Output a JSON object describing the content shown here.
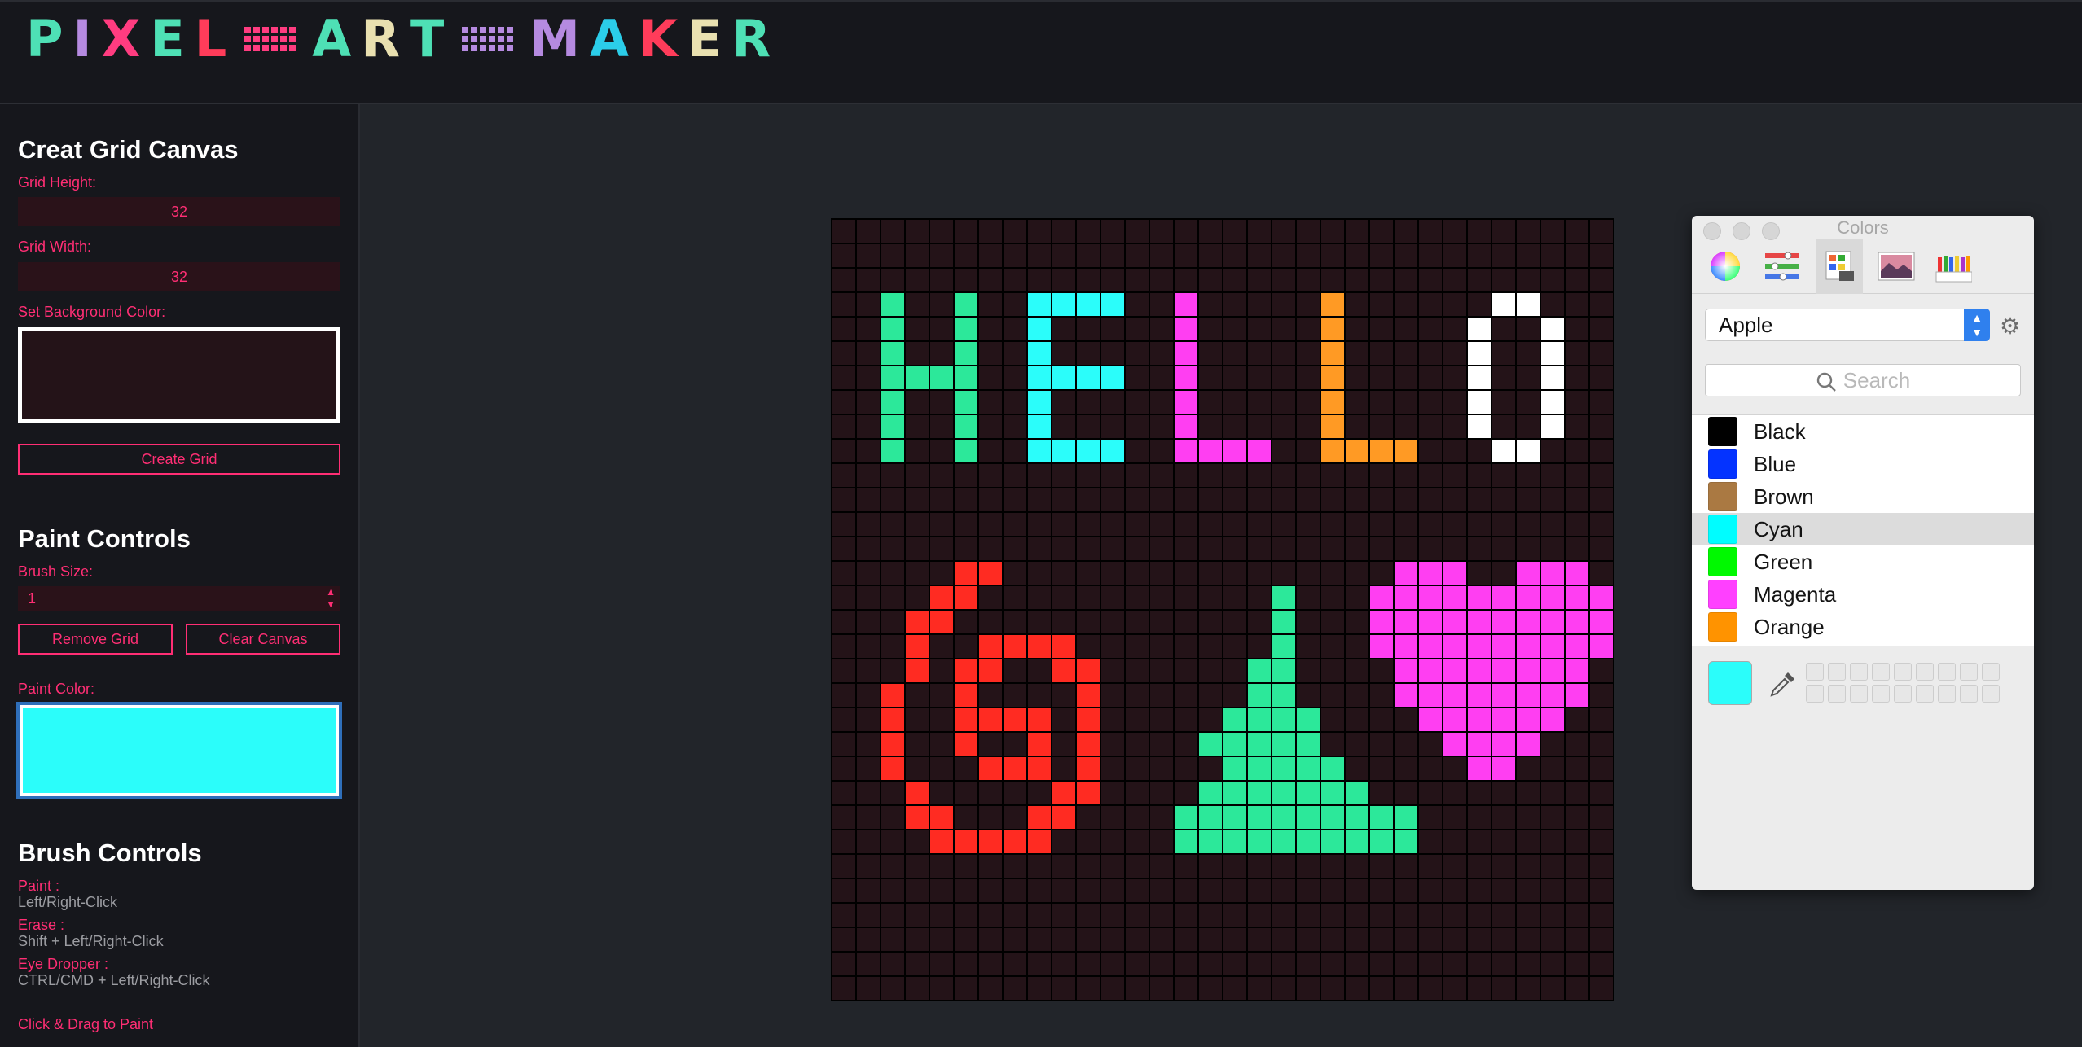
{
  "logo": {
    "letters": [
      {
        "ch": "P",
        "color": "#4ee0b5"
      },
      {
        "ch": "I",
        "color": "#b58ae0"
      },
      {
        "ch": "X",
        "color": "#ff3c80"
      },
      {
        "ch": "E",
        "color": "#4ee0b5"
      },
      {
        "ch": "L",
        "color": "#ff3c5a"
      },
      {
        "sep": true,
        "color": "#ff3c80"
      },
      {
        "ch": "A",
        "color": "#4ee0b5"
      },
      {
        "ch": "R",
        "color": "#e9e0b0"
      },
      {
        "ch": "T",
        "color": "#4ee0b5"
      },
      {
        "sep": true,
        "color": "#b58ae0"
      },
      {
        "ch": "M",
        "color": "#b58ae0"
      },
      {
        "ch": "A",
        "color": "#2bcde9"
      },
      {
        "ch": "K",
        "color": "#ff3c5a"
      },
      {
        "ch": "E",
        "color": "#e9e0b0"
      },
      {
        "ch": "R",
        "color": "#4ee0b5"
      }
    ]
  },
  "sidebar": {
    "create_title": "Creat Grid Canvas",
    "grid_height_label": "Grid Height:",
    "grid_height_value": "32",
    "grid_width_label": "Grid Width:",
    "grid_width_value": "32",
    "bg_color_label": "Set Background Color:",
    "bg_color": "#241318",
    "create_button": "Create Grid",
    "paint_title": "Paint Controls",
    "brush_size_label": "Brush Size:",
    "brush_size_value": "1",
    "remove_grid_button": "Remove Grid",
    "clear_canvas_button": "Clear Canvas",
    "paint_color_label": "Paint Color:",
    "paint_color": "#2bfdfa",
    "brush_title": "Brush Controls",
    "paint_label": "Paint :",
    "paint_hint": "Left/Right-Click",
    "erase_label": "Erase :",
    "erase_hint": "Shift + Left/Right-Click",
    "eyedropper_label": "Eye Dropper :",
    "eyedropper_hint": "CTRL/CMD + Left/Right-Click",
    "drag_hint": "Click & Drag to Paint"
  },
  "canvas": {
    "rows": 32,
    "cols": 32,
    "background": "#241318",
    "pixels": [
      {
        "color": "#2ce89a",
        "cells": [
          [
            3,
            2
          ],
          [
            4,
            2
          ],
          [
            5,
            2
          ],
          [
            6,
            2
          ],
          [
            7,
            2
          ],
          [
            8,
            2
          ],
          [
            9,
            2
          ],
          [
            3,
            5
          ],
          [
            4,
            5
          ],
          [
            5,
            5
          ],
          [
            6,
            5
          ],
          [
            7,
            5
          ],
          [
            8,
            5
          ],
          [
            9,
            5
          ],
          [
            6,
            3
          ],
          [
            6,
            4
          ]
        ]
      },
      {
        "color": "#2bfdfa",
        "cells": [
          [
            3,
            8
          ],
          [
            3,
            9
          ],
          [
            3,
            10
          ],
          [
            3,
            11
          ],
          [
            4,
            8
          ],
          [
            5,
            8
          ],
          [
            6,
            8
          ],
          [
            7,
            8
          ],
          [
            8,
            8
          ],
          [
            9,
            8
          ],
          [
            6,
            9
          ],
          [
            6,
            10
          ],
          [
            6,
            11
          ],
          [
            9,
            9
          ],
          [
            9,
            10
          ],
          [
            9,
            11
          ]
        ]
      },
      {
        "color": "#ff3ef2",
        "cells": [
          [
            3,
            14
          ],
          [
            4,
            14
          ],
          [
            5,
            14
          ],
          [
            6,
            14
          ],
          [
            7,
            14
          ],
          [
            8,
            14
          ],
          [
            9,
            14
          ],
          [
            9,
            15
          ],
          [
            9,
            16
          ],
          [
            9,
            17
          ]
        ]
      },
      {
        "color": "#ff9a24",
        "cells": [
          [
            3,
            20
          ],
          [
            4,
            20
          ],
          [
            5,
            20
          ],
          [
            6,
            20
          ],
          [
            7,
            20
          ],
          [
            8,
            20
          ],
          [
            9,
            20
          ],
          [
            9,
            21
          ],
          [
            9,
            22
          ],
          [
            9,
            23
          ]
        ]
      },
      {
        "color": "#ffffff",
        "cells": [
          [
            3,
            27
          ],
          [
            3,
            28
          ],
          [
            4,
            26
          ],
          [
            5,
            26
          ],
          [
            6,
            26
          ],
          [
            7,
            26
          ],
          [
            8,
            26
          ],
          [
            4,
            29
          ],
          [
            5,
            29
          ],
          [
            6,
            29
          ],
          [
            7,
            29
          ],
          [
            8,
            29
          ],
          [
            9,
            27
          ],
          [
            9,
            28
          ]
        ]
      },
      {
        "color": "#ff2b22",
        "cells": [
          [
            14,
            5
          ],
          [
            14,
            6
          ],
          [
            15,
            4
          ],
          [
            15,
            5
          ],
          [
            16,
            3
          ],
          [
            16,
            4
          ],
          [
            17,
            3
          ],
          [
            18,
            3
          ],
          [
            19,
            2
          ],
          [
            20,
            2
          ],
          [
            21,
            2
          ],
          [
            22,
            2
          ],
          [
            23,
            3
          ],
          [
            24,
            3
          ],
          [
            24,
            4
          ],
          [
            25,
            4
          ],
          [
            25,
            5
          ],
          [
            25,
            6
          ],
          [
            25,
            7
          ],
          [
            25,
            8
          ],
          [
            24,
            8
          ],
          [
            24,
            9
          ],
          [
            23,
            9
          ],
          [
            23,
            10
          ],
          [
            22,
            10
          ],
          [
            21,
            10
          ],
          [
            20,
            10
          ],
          [
            19,
            10
          ],
          [
            18,
            10
          ],
          [
            18,
            9
          ],
          [
            17,
            9
          ],
          [
            17,
            8
          ],
          [
            17,
            7
          ],
          [
            17,
            6
          ],
          [
            18,
            6
          ],
          [
            18,
            5
          ],
          [
            19,
            5
          ],
          [
            20,
            5
          ],
          [
            21,
            5
          ],
          [
            22,
            6
          ],
          [
            22,
            7
          ],
          [
            22,
            8
          ],
          [
            21,
            8
          ],
          [
            20,
            8
          ],
          [
            20,
            7
          ],
          [
            20,
            6
          ]
        ]
      },
      {
        "color": "#2ce89a",
        "cells": [
          [
            15,
            18
          ],
          [
            16,
            18
          ],
          [
            17,
            18
          ],
          [
            18,
            17
          ],
          [
            18,
            18
          ],
          [
            19,
            17
          ],
          [
            19,
            18
          ],
          [
            20,
            17
          ],
          [
            20,
            18
          ],
          [
            20,
            19
          ],
          [
            21,
            16
          ],
          [
            21,
            17
          ],
          [
            21,
            18
          ],
          [
            21,
            19
          ],
          [
            22,
            16
          ],
          [
            22,
            17
          ],
          [
            22,
            18
          ],
          [
            22,
            19
          ],
          [
            22,
            20
          ],
          [
            23,
            15
          ],
          [
            23,
            16
          ],
          [
            23,
            17
          ],
          [
            23,
            18
          ],
          [
            23,
            19
          ],
          [
            23,
            20
          ],
          [
            23,
            21
          ],
          [
            24,
            14
          ],
          [
            24,
            15
          ],
          [
            24,
            16
          ],
          [
            24,
            17
          ],
          [
            24,
            18
          ],
          [
            24,
            19
          ],
          [
            24,
            20
          ],
          [
            24,
            21
          ],
          [
            24,
            22
          ],
          [
            24,
            23
          ],
          [
            25,
            14
          ],
          [
            25,
            15
          ],
          [
            25,
            16
          ],
          [
            25,
            17
          ],
          [
            25,
            18
          ],
          [
            25,
            19
          ],
          [
            25,
            20
          ],
          [
            25,
            21
          ],
          [
            25,
            22
          ],
          [
            25,
            23
          ],
          [
            20,
            16
          ],
          [
            21,
            15
          ]
        ]
      },
      {
        "color": "#ff3ef2",
        "cells": [
          [
            14,
            23
          ],
          [
            14,
            24
          ],
          [
            14,
            25
          ],
          [
            14,
            28
          ],
          [
            14,
            29
          ],
          [
            14,
            30
          ],
          [
            15,
            22
          ],
          [
            15,
            23
          ],
          [
            15,
            24
          ],
          [
            15,
            25
          ],
          [
            15,
            26
          ],
          [
            15,
            27
          ],
          [
            15,
            28
          ],
          [
            15,
            29
          ],
          [
            15,
            30
          ],
          [
            15,
            31
          ],
          [
            16,
            22
          ],
          [
            16,
            23
          ],
          [
            16,
            24
          ],
          [
            16,
            25
          ],
          [
            16,
            26
          ],
          [
            16,
            27
          ],
          [
            16,
            28
          ],
          [
            16,
            29
          ],
          [
            16,
            30
          ],
          [
            16,
            31
          ],
          [
            17,
            22
          ],
          [
            17,
            23
          ],
          [
            17,
            24
          ],
          [
            17,
            25
          ],
          [
            17,
            26
          ],
          [
            17,
            27
          ],
          [
            17,
            28
          ],
          [
            17,
            29
          ],
          [
            17,
            30
          ],
          [
            17,
            31
          ],
          [
            18,
            23
          ],
          [
            18,
            24
          ],
          [
            18,
            25
          ],
          [
            18,
            26
          ],
          [
            18,
            27
          ],
          [
            18,
            28
          ],
          [
            18,
            29
          ],
          [
            18,
            30
          ],
          [
            19,
            23
          ],
          [
            19,
            24
          ],
          [
            19,
            25
          ],
          [
            19,
            26
          ],
          [
            19,
            27
          ],
          [
            19,
            28
          ],
          [
            19,
            29
          ],
          [
            19,
            30
          ],
          [
            20,
            24
          ],
          [
            20,
            25
          ],
          [
            20,
            26
          ],
          [
            20,
            27
          ],
          [
            20,
            28
          ],
          [
            20,
            29
          ],
          [
            21,
            25
          ],
          [
            21,
            26
          ],
          [
            21,
            27
          ],
          [
            21,
            28
          ],
          [
            22,
            26
          ],
          [
            22,
            27
          ]
        ]
      }
    ]
  },
  "colors_panel": {
    "title": "Colors",
    "palette_list": "Apple",
    "search_placeholder": "Search",
    "selected_color": "#2bfdfa",
    "items": [
      {
        "name": "Black",
        "color": "#000000"
      },
      {
        "name": "Blue",
        "color": "#0433ff"
      },
      {
        "name": "Brown",
        "color": "#aa7942"
      },
      {
        "name": "Cyan",
        "color": "#00fdff",
        "selected": true
      },
      {
        "name": "Green",
        "color": "#00f900"
      },
      {
        "name": "Magenta",
        "color": "#ff40ff"
      },
      {
        "name": "Orange",
        "color": "#ff9300"
      }
    ]
  }
}
